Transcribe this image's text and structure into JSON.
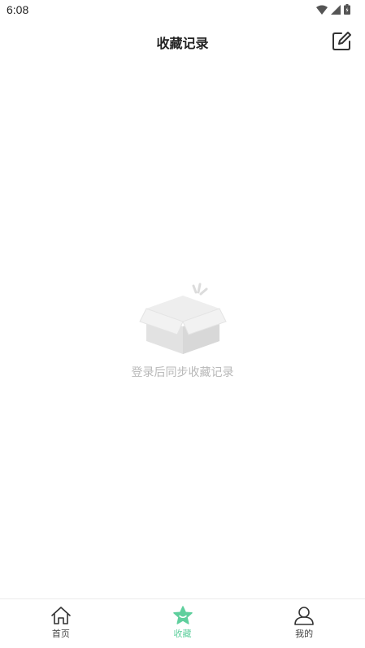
{
  "status_bar": {
    "time": "6:08"
  },
  "header": {
    "title": "收藏记录",
    "edit_icon": "edit-icon"
  },
  "empty_state": {
    "icon": "open-box-icon",
    "message": "登录后同步收藏记录"
  },
  "tabbar": {
    "active_color": "#5fcf9d",
    "tabs": [
      {
        "label": "首页",
        "icon": "home-icon",
        "active": false
      },
      {
        "label": "收藏",
        "icon": "star-icon",
        "active": true
      },
      {
        "label": "我的",
        "icon": "profile-icon",
        "active": false
      }
    ]
  }
}
